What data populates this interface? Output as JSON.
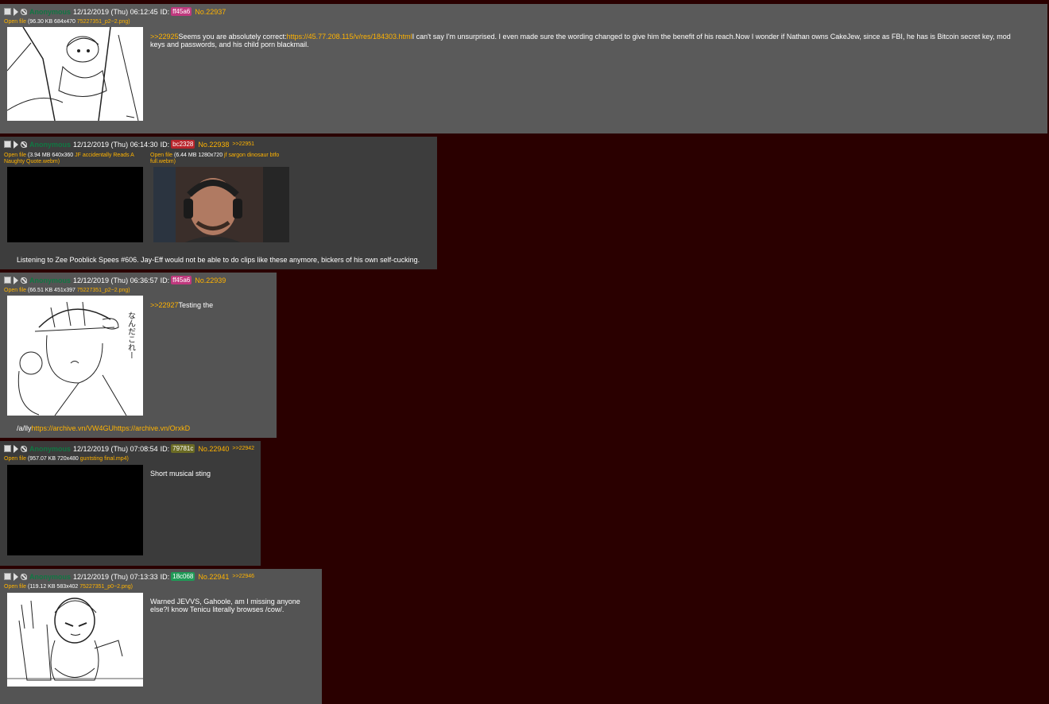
{
  "posts": [
    {
      "name": "Anonymous",
      "date": "12/12/2019 (Thu) 06:12:45",
      "id_label": "ID:",
      "uid": "ff45a6",
      "uid_color": "#c0397e",
      "no": "No.22937",
      "backlinks": "",
      "files": [
        {
          "open": "Open file",
          "meta": "(96.30 KB 684x470",
          "fname": "75227351_p2~2.png)"
        }
      ],
      "body_quote": ">>22925",
      "body_text1": "Seems you are absolutely correct:",
      "body_link": "https://45.77.208.115/v/res/184303.html",
      "body_text2": "I can't say I'm unsurprised. I even made sure the wording changed to give him the benefit of his reach.Now I wonder if Nathan owns CakeJew, since as FBI, he has is Bitcoin secret key, mod keys and passwords, and his child porn blackmail."
    },
    {
      "name": "Anonymous",
      "date": "12/12/2019 (Thu) 06:14:30",
      "id_label": "ID:",
      "uid": "bc2328",
      "uid_color": "#b8242b",
      "no": "No.22938",
      "backlinks": ">>22951",
      "files": [
        {
          "open": "Open file",
          "meta": "(3.94 MB 640x360",
          "fname": "JF accidentally Reads A Naughty Quote.webm)"
        },
        {
          "open": "Open file",
          "meta": "(6.44 MB 1280x720",
          "fname": "jf sargon dinosaur btfo full.webm)"
        }
      ],
      "body_text": "Listening to Zee Pooblick Spees #606. Jay-Eff would not be able to do clips like these anymore, bickers of his own self-cucking."
    },
    {
      "name": "Anonymous",
      "date": "12/12/2019 (Thu) 06:36:57",
      "id_label": "ID:",
      "uid": "ff45a6",
      "uid_color": "#c0397e",
      "no": "No.22939",
      "backlinks": "",
      "files": [
        {
          "open": "Open file",
          "meta": "(66.51 KB 451x397",
          "fname": "75227351_p2~2.png)"
        }
      ],
      "body_quote": ">>22927",
      "body_text1": "Testing the",
      "body_bottom_text": "/a/lly",
      "body_bottom_link": "https://archive.vn/VW4GUhttps://archive.vn/OrxkD"
    },
    {
      "name": "Anonymous",
      "date": "12/12/2019 (Thu) 07:08:54",
      "id_label": "ID:",
      "uid": "79781c",
      "uid_color": "#6b6b24",
      "no": "No.22940",
      "backlinks": ">>22942",
      "files": [
        {
          "open": "Open file",
          "meta": "(957.07 KB 720x480",
          "fname": "guntsting final.mp4)"
        }
      ],
      "body_text1": "Short musical sting"
    },
    {
      "name": "Anonymous",
      "date": "12/12/2019 (Thu) 07:13:33",
      "id_label": "ID:",
      "uid": "18c068",
      "uid_color": "#1f9a56",
      "no": "No.22941",
      "backlinks": ">>22946",
      "files": [
        {
          "open": "Open file",
          "meta": "(119.12 KB 583x402",
          "fname": "75227351_p0~2.png)"
        }
      ],
      "body_text1": "Warned JEVVS, Gahoole, am I missing anyone else?I know Tenicu literally browses /cow/."
    }
  ]
}
